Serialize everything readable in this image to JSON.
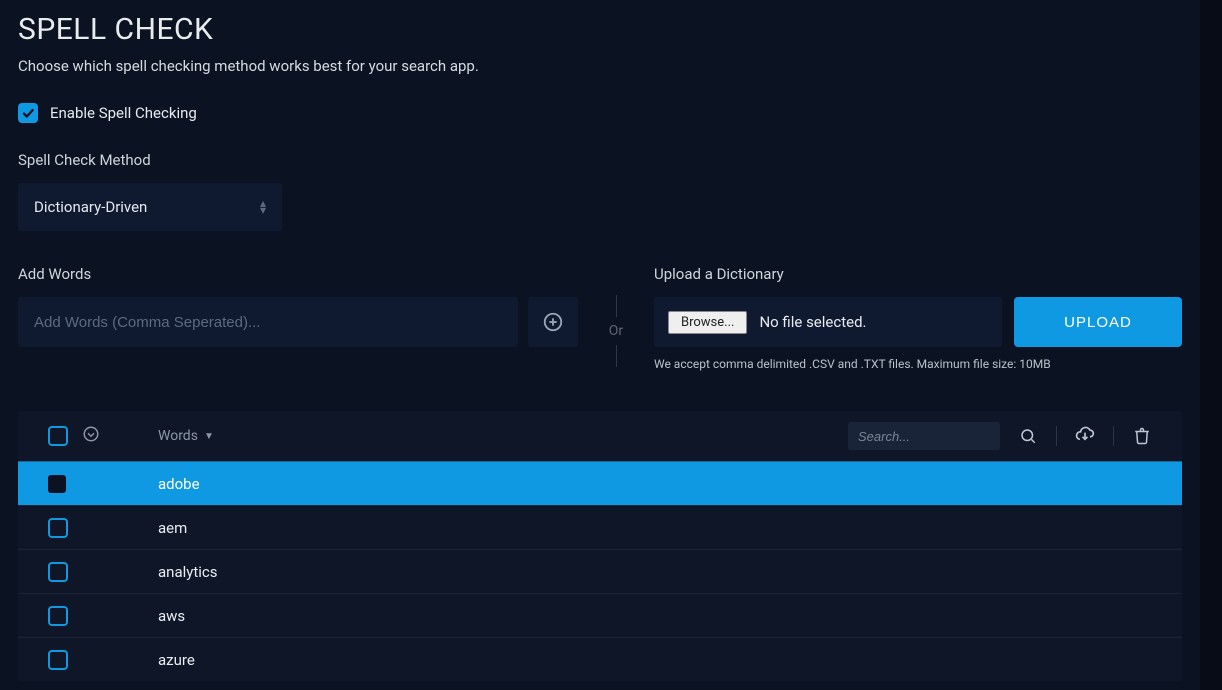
{
  "header": {
    "title": "SPELL CHECK",
    "subtitle": "Choose which spell checking method works best for your search app."
  },
  "enable": {
    "label": "Enable Spell Checking",
    "checked": true
  },
  "method": {
    "label": "Spell Check Method",
    "selected": "Dictionary-Driven"
  },
  "addWords": {
    "label": "Add Words",
    "placeholder": "Add Words (Comma Seperated)..."
  },
  "or": "Or",
  "upload": {
    "label": "Upload a Dictionary",
    "browse": "Browse...",
    "status": "No file selected.",
    "button": "UPLOAD",
    "hint": "We accept comma delimited .CSV and .TXT files. Maximum file size: 10MB"
  },
  "table": {
    "column": "Words",
    "searchPlaceholder": "Search...",
    "rows": [
      {
        "word": "adobe",
        "selected": true
      },
      {
        "word": "aem",
        "selected": false
      },
      {
        "word": "analytics",
        "selected": false
      },
      {
        "word": "aws",
        "selected": false
      },
      {
        "word": "azure",
        "selected": false
      }
    ]
  }
}
